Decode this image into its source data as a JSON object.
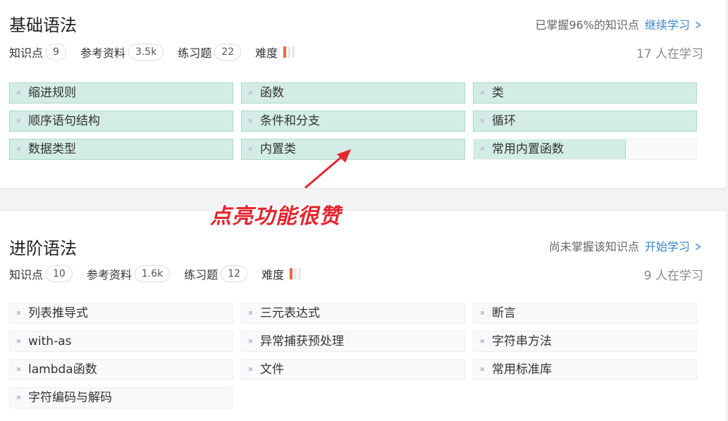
{
  "sections": [
    {
      "title": "基础语法",
      "status_text": "已掌握96%的知识点",
      "action": "继续学习",
      "meta": {
        "kp_label": "知识点",
        "kp_count": "9",
        "ref_label": "参考资料",
        "ref_count": "3.5k",
        "ex_label": "练习题",
        "ex_count": "22",
        "diff_label": "难度",
        "difficulty": 1
      },
      "learners": "17 人在学习",
      "items": [
        {
          "label": "缩进规则",
          "progress": 1.0
        },
        {
          "label": "函数",
          "progress": 1.0
        },
        {
          "label": "类",
          "progress": 1.0
        },
        {
          "label": "顺序语句结构",
          "progress": 1.0
        },
        {
          "label": "条件和分支",
          "progress": 1.0
        },
        {
          "label": "循环",
          "progress": 1.0
        },
        {
          "label": "数据类型",
          "progress": 1.0
        },
        {
          "label": "内置类",
          "progress": 1.0
        },
        {
          "label": "常用内置函数",
          "progress": 0.68
        }
      ]
    },
    {
      "title": "进阶语法",
      "status_text": "尚未掌握该知识点",
      "action": "开始学习",
      "meta": {
        "kp_label": "知识点",
        "kp_count": "10",
        "ref_label": "参考资料",
        "ref_count": "1.6k",
        "ex_label": "练习题",
        "ex_count": "12",
        "diff_label": "难度",
        "difficulty": 1
      },
      "learners": "9 人在学习",
      "items": [
        {
          "label": "列表推导式",
          "progress": 0
        },
        {
          "label": "三元表达式",
          "progress": 0
        },
        {
          "label": "断言",
          "progress": 0
        },
        {
          "label": "with-as",
          "progress": 0
        },
        {
          "label": "异常捕获预处理",
          "progress": 0
        },
        {
          "label": "字符串方法",
          "progress": 0
        },
        {
          "label": "lambda函数",
          "progress": 0
        },
        {
          "label": "文件",
          "progress": 0
        },
        {
          "label": "常用标准库",
          "progress": 0
        },
        {
          "label": "字符编码与解码",
          "progress": 0
        }
      ]
    }
  ],
  "annotation": {
    "text": "点亮功能很赞",
    "color": "#e3262f"
  },
  "colors": {
    "accent": "#3a86c6",
    "mastered_fill": "#d3ece6",
    "difficulty": "#f0663a"
  }
}
